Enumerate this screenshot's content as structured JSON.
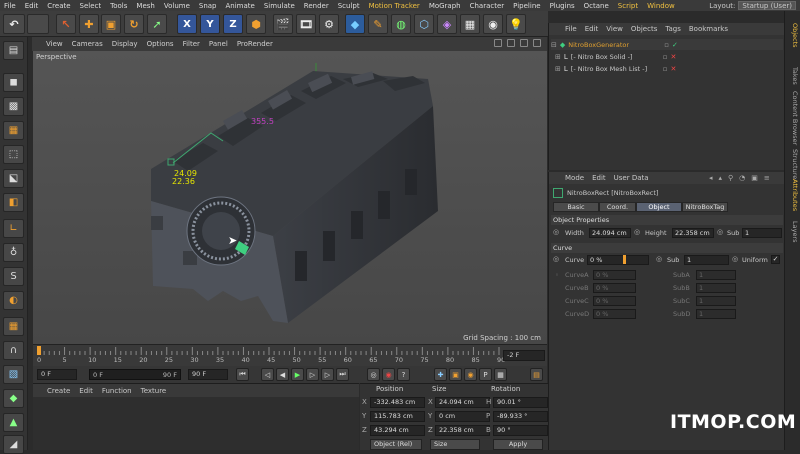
{
  "menubar": {
    "items": [
      "File",
      "Edit",
      "Create",
      "Select",
      "Tools",
      "Mesh",
      "Volume",
      "Snap",
      "Animate",
      "Simulate",
      "Render",
      "Sculpt",
      "Motion Tracker",
      "MoGraph",
      "Character",
      "Pipeline",
      "Plugins",
      "Octane",
      "Script",
      "Window"
    ],
    "layout_label": "Layout:",
    "layout_value": "Startup (User)"
  },
  "toolbar": {
    "axis_x": "X",
    "axis_y": "Y",
    "axis_z": "Z"
  },
  "viewport": {
    "menu": [
      "View",
      "Cameras",
      "Display",
      "Options",
      "Filter",
      "Panel",
      "ProRender"
    ],
    "label": "Perspective",
    "grid_spacing": "Grid Spacing : 100 cm",
    "annotation_width": "24.09",
    "annotation_height": "22.36",
    "annotation_top": "355.5"
  },
  "timeline": {
    "ticks": [
      "0",
      "5",
      "10",
      "15",
      "20",
      "25",
      "30",
      "35",
      "40",
      "45",
      "50",
      "55",
      "60",
      "65",
      "70",
      "75",
      "80",
      "85",
      "90"
    ],
    "current_frame": "-2 F"
  },
  "transport": {
    "start_frame": "0 F",
    "min_frame": "0 F",
    "max_frame": "90 F",
    "end_frame": "90 F"
  },
  "materials": {
    "menu": [
      "Create",
      "Edit",
      "Function",
      "Texture"
    ]
  },
  "coordinates": {
    "headers": [
      "Position",
      "Size",
      "Rotation"
    ],
    "rows": [
      {
        "pl": "X",
        "pv": "-332.483 cm",
        "sl": "X",
        "sv": "24.094 cm",
        "rl": "H",
        "rv": "90.01 °"
      },
      {
        "pl": "Y",
        "pv": "115.783 cm",
        "sl": "Y",
        "sv": "0 cm",
        "rl": "P",
        "rv": "-89.933 °"
      },
      {
        "pl": "Z",
        "pv": "43.294 cm",
        "sl": "Z",
        "sv": "22.358 cm",
        "rl": "B",
        "rv": "90 °"
      }
    ],
    "mode1": "Object (Rel)",
    "mode2": "Size",
    "apply": "Apply"
  },
  "objects": {
    "menu": [
      "File",
      "Edit",
      "View",
      "Objects",
      "Tags",
      "Bookmarks"
    ],
    "items": [
      {
        "name": "NitroBoxGenerator",
        "color": "#e0a030"
      },
      {
        "name": "[- Nitro Box Solid -]",
        "color": "#c8c8c8"
      },
      {
        "name": "[- Nitro Box Mesh List -]",
        "color": "#c8c8c8"
      }
    ]
  },
  "attributes": {
    "menu": [
      "Mode",
      "Edit",
      "User Data"
    ],
    "object_name": "NitroBoxRect [NitroBoxRect]",
    "tabs": [
      "Basic",
      "Coord.",
      "Object",
      "NitroBoxTag"
    ],
    "active_tab": "Object",
    "section1": "Object Properties",
    "width_label": "Width",
    "width_value": "24.094 cm",
    "height_label": "Height",
    "height_value": "22.358 cm",
    "sub_label": "Sub",
    "sub_value": "1",
    "section2": "Curve",
    "curve_label": "Curve",
    "curve_value": "0 %",
    "curve_sub_label": "Sub",
    "curve_sub_value": "1",
    "uniform_label": "Uniform",
    "curve_rows": [
      {
        "a": "CurveA",
        "av": "0 %",
        "b": "SubA",
        "bv": "1"
      },
      {
        "a": "CurveB",
        "av": "0 %",
        "b": "SubB",
        "bv": "1"
      },
      {
        "a": "CurveC",
        "av": "0 %",
        "b": "SubC",
        "bv": "1"
      },
      {
        "a": "CurveD",
        "av": "0 %",
        "b": "SubD",
        "bv": "1"
      }
    ]
  },
  "side_tabs": [
    "Objects",
    "Takes",
    "Content Browser",
    "Structure",
    "Attributes",
    "Layers"
  ],
  "watermark": "ITMOP.COM"
}
